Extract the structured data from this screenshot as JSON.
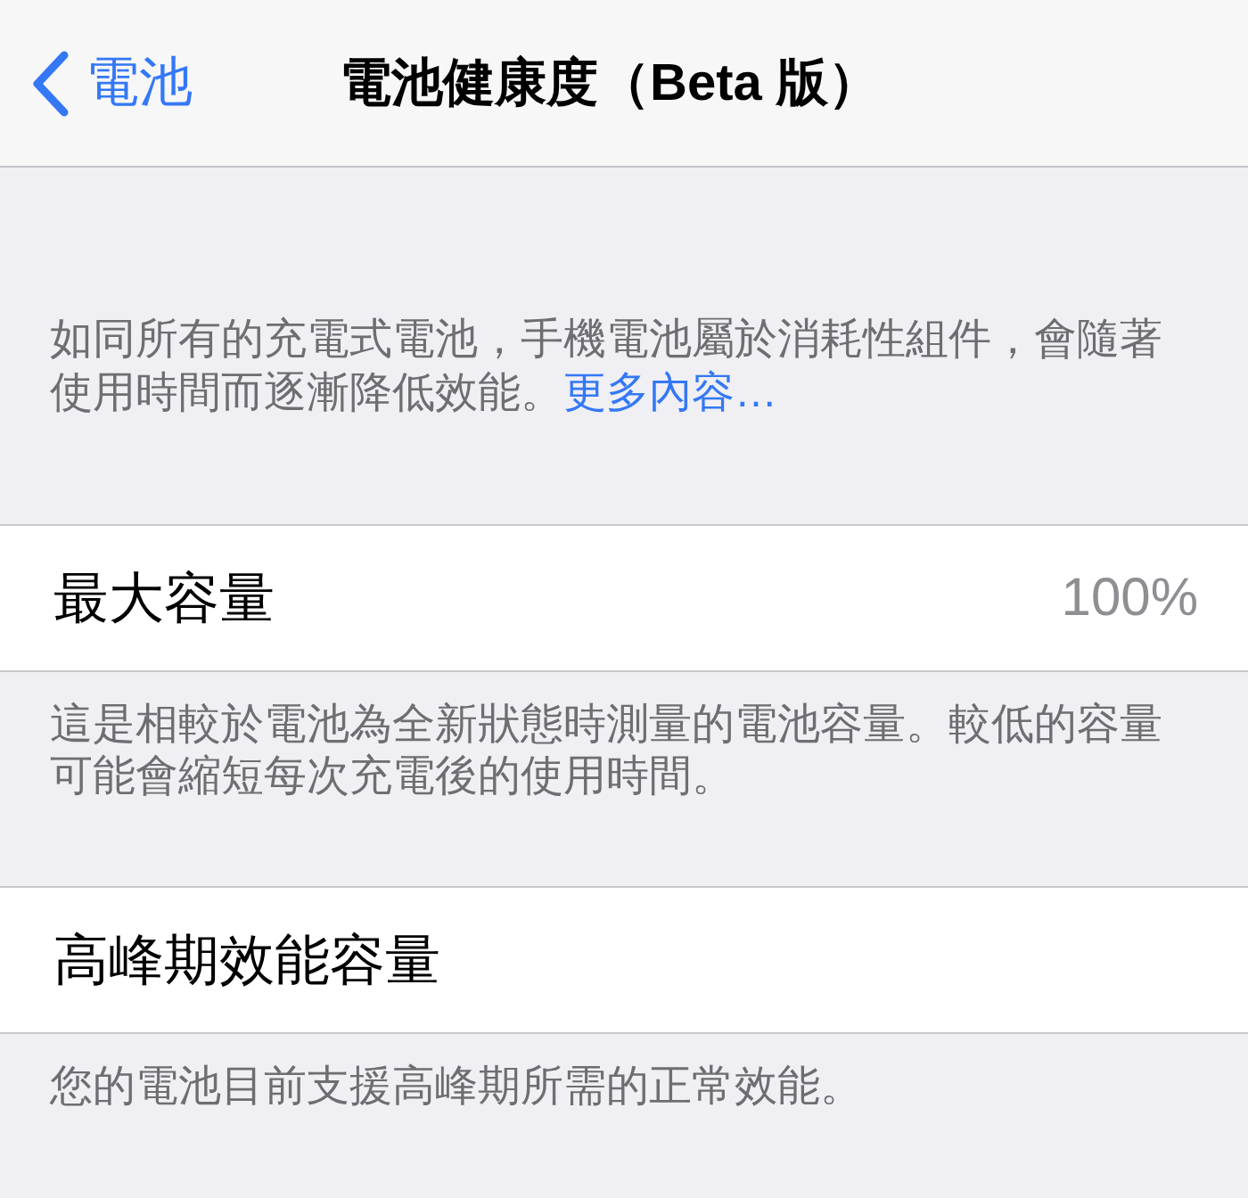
{
  "nav_bar": {
    "back_button": {
      "label": "電池"
    },
    "title": "電池健康度（Beta 版）"
  },
  "intro": {
    "text": "如同所有的充電式電池，手機電池屬於消耗性組件，會隨著使用時間而逐漸降低效能。",
    "link": "更多內容…"
  },
  "sections": [
    {
      "label": "最大容量",
      "value": "100%",
      "footer": "這是相較於電池為全新狀態時測量的電池容量。較低的容量可能會縮短每次充電後的使用時間。"
    },
    {
      "label": "高峰期效能容量",
      "footer": "您的電池目前支援高峰期所需的正常效能。"
    }
  ]
}
